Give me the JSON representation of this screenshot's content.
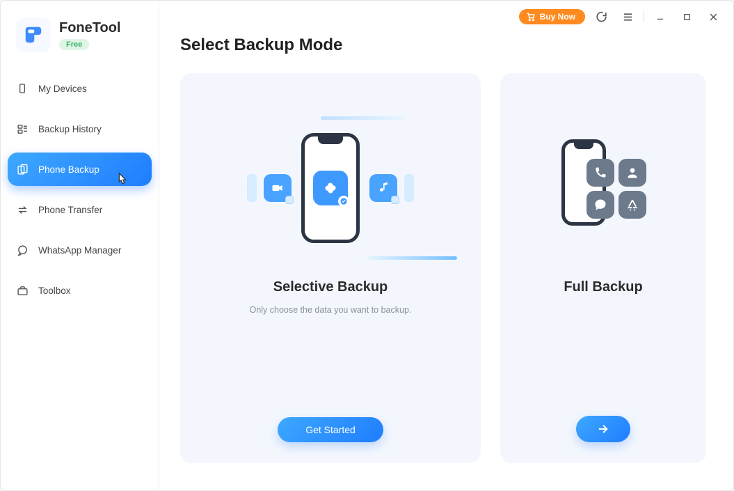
{
  "titlebar": {
    "buy_label": "Buy Now"
  },
  "brand": {
    "name": "FoneTool",
    "tier_label": "Free"
  },
  "sidebar": {
    "items": [
      {
        "label": "My Devices"
      },
      {
        "label": "Backup History"
      },
      {
        "label": "Phone Backup"
      },
      {
        "label": "Phone Transfer"
      },
      {
        "label": "WhatsApp Manager"
      },
      {
        "label": "Toolbox"
      }
    ]
  },
  "page": {
    "title": "Select Backup Mode"
  },
  "modes": {
    "selective": {
      "title": "Selective Backup",
      "subtitle": "Only choose the data you want to backup.",
      "cta": "Get Started"
    },
    "full": {
      "title": "Full Backup"
    }
  }
}
